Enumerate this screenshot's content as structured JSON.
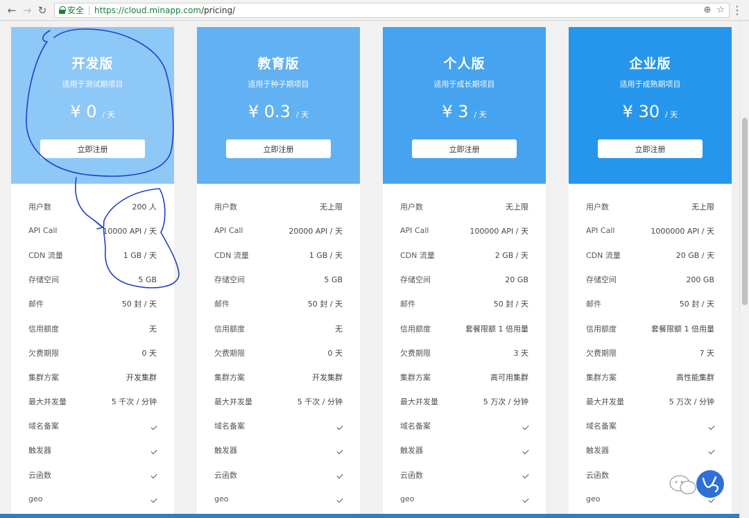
{
  "browser": {
    "back_icon": "arrow-left-icon",
    "forward_icon": "arrow-right-icon",
    "reload_icon": "reload-icon",
    "secure_label": "安全",
    "url_host": "https://cloud.minapp.com",
    "url_path": "/pricing/"
  },
  "plans": [
    {
      "name": "开发版",
      "desc": "适用于测试期项目",
      "price": "¥ 0",
      "unit": "/ 天",
      "button": "立即注册",
      "color": "#8ec8f6",
      "features": [
        {
          "label": "用户数",
          "value": "200 人"
        },
        {
          "label": "API Call",
          "value": "10000 API / 天"
        },
        {
          "label": "CDN 流量",
          "value": "1 GB / 天"
        },
        {
          "label": "存储空间",
          "value": "5 GB"
        },
        {
          "label": "邮件",
          "value": "50 封 / 天"
        },
        {
          "label": "信用额度",
          "value": "无"
        },
        {
          "label": "欠费期限",
          "value": "0 天"
        },
        {
          "label": "集群方案",
          "value": "开发集群"
        },
        {
          "label": "最大并发量",
          "value": "5 千次 / 分钟"
        },
        {
          "label": "域名备案",
          "value": "✓"
        },
        {
          "label": "触发器",
          "value": "✓"
        },
        {
          "label": "云函数",
          "value": "✓"
        },
        {
          "label": "geo",
          "value": "✓"
        }
      ]
    },
    {
      "name": "教育版",
      "desc": "适用于种子期项目",
      "price": "¥ 0.3",
      "unit": "/ 天",
      "button": "立即注册",
      "color": "#62b1f2",
      "features": [
        {
          "label": "用户数",
          "value": "无上限"
        },
        {
          "label": "API Call",
          "value": "20000 API / 天"
        },
        {
          "label": "CDN 流量",
          "value": "1 GB / 天"
        },
        {
          "label": "存储空间",
          "value": "5 GB"
        },
        {
          "label": "邮件",
          "value": "50 封 / 天"
        },
        {
          "label": "信用额度",
          "value": "无"
        },
        {
          "label": "欠费期限",
          "value": "0 天"
        },
        {
          "label": "集群方案",
          "value": "开发集群"
        },
        {
          "label": "最大并发量",
          "value": "5 千次 / 分钟"
        },
        {
          "label": "域名备案",
          "value": "✓"
        },
        {
          "label": "触发器",
          "value": "✓"
        },
        {
          "label": "云函数",
          "value": "✓"
        },
        {
          "label": "geo",
          "value": "✓"
        }
      ]
    },
    {
      "name": "个人版",
      "desc": "适用于成长期项目",
      "price": "¥ 3",
      "unit": "/ 天",
      "button": "立即注册",
      "color": "#45a3ef",
      "features": [
        {
          "label": "用户数",
          "value": "无上限"
        },
        {
          "label": "API Call",
          "value": "100000 API / 天"
        },
        {
          "label": "CDN 流量",
          "value": "2 GB / 天"
        },
        {
          "label": "存储空间",
          "value": "20 GB"
        },
        {
          "label": "邮件",
          "value": "50 封 / 天"
        },
        {
          "label": "信用额度",
          "value": "套餐限额 1 倍用量"
        },
        {
          "label": "欠费期限",
          "value": "3 天"
        },
        {
          "label": "集群方案",
          "value": "高可用集群"
        },
        {
          "label": "最大并发量",
          "value": "5 万次 / 分钟"
        },
        {
          "label": "域名备案",
          "value": "✓"
        },
        {
          "label": "触发器",
          "value": "✓"
        },
        {
          "label": "云函数",
          "value": "✓"
        },
        {
          "label": "geo",
          "value": "✓"
        }
      ]
    },
    {
      "name": "企业版",
      "desc": "适用于成熟期项目",
      "price": "¥ 30",
      "unit": "/ 天",
      "button": "立即注册",
      "color": "#2596ec",
      "features": [
        {
          "label": "用户数",
          "value": "无上限"
        },
        {
          "label": "API Call",
          "value": "1000000 API / 天"
        },
        {
          "label": "CDN 流量",
          "value": "20 GB / 天"
        },
        {
          "label": "存储空间",
          "value": "200 GB"
        },
        {
          "label": "邮件",
          "value": "50 封 / 天"
        },
        {
          "label": "信用额度",
          "value": "套餐限额 1 倍用量"
        },
        {
          "label": "欠费期限",
          "value": "7 天"
        },
        {
          "label": "集群方案",
          "value": "高性能集群"
        },
        {
          "label": "最大并发量",
          "value": "5 万次 / 分钟"
        },
        {
          "label": "域名备案",
          "value": "✓"
        },
        {
          "label": "触发器",
          "value": "✓"
        },
        {
          "label": "云函数",
          "value": "✓"
        },
        {
          "label": "geo",
          "value": "✓"
        }
      ]
    }
  ],
  "annotation_color": "#1f3fc4"
}
